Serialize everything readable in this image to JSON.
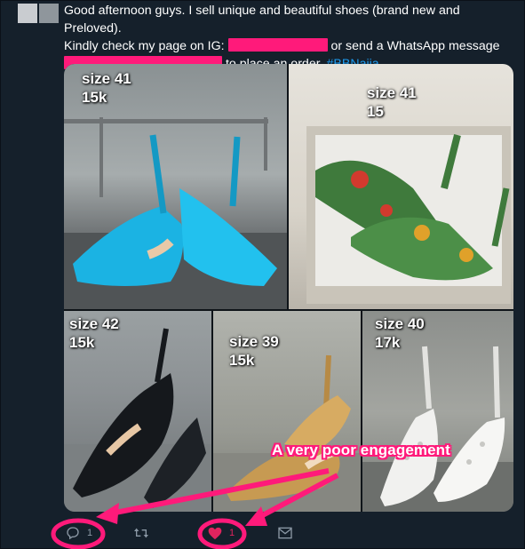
{
  "tweet": {
    "text_line1": "Good afternoon guys. I sell unique and beautiful shoes (brand new and Preloved).",
    "text_line2_a": "Kindly check my page on IG:",
    "text_line2_b": "or send a WhatsApp message",
    "text_line3": "to place an order.",
    "hashtag": "#BBNaija"
  },
  "media": {
    "photos": [
      {
        "label": "size 41\n15k"
      },
      {
        "label": "size 41\n15"
      },
      {
        "label": "size 42\n15k"
      },
      {
        "label": "size 39\n15k"
      },
      {
        "label": "size 40\n17k"
      }
    ]
  },
  "annotation": {
    "text": "A very poor engagement",
    "color": "#ff1a7a"
  },
  "actions": {
    "reply_count": "1",
    "like_count": "1",
    "icons": [
      "reply-icon",
      "retweet-icon",
      "like-icon",
      "dm-icon"
    ]
  },
  "colors": {
    "background": "#15202b",
    "secondary": "#8b98a5",
    "like": "#e0245e",
    "link": "#1d9bf0"
  }
}
